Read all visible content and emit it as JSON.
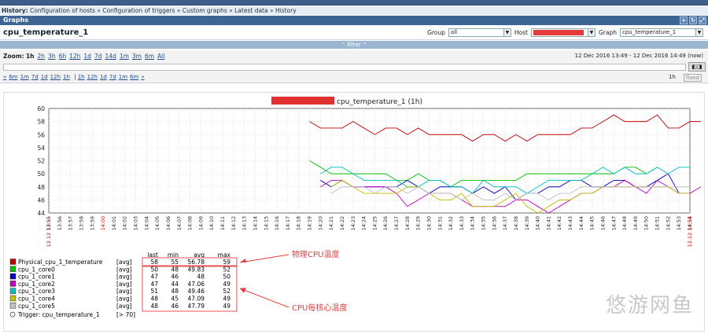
{
  "history": {
    "label": "History:",
    "crumbs": "Configuration of hosts » Configuration of triggers » Custom graphs » Latest data » History"
  },
  "header": {
    "section": "Graphs"
  },
  "page_title": "cpu_temperature_1",
  "filters": {
    "group_label": "Group",
    "group_value": "all",
    "host_label": "Host",
    "graph_label": "Graph",
    "graph_value": "cpu_temperature_1"
  },
  "filter_bar": "⌃ Filter ⌃",
  "zoom": {
    "label": "Zoom:",
    "options": [
      "1h",
      "2h",
      "3h",
      "6h",
      "12h",
      "1d",
      "7d",
      "14d",
      "1m",
      "3m",
      "6m",
      "All"
    ],
    "range_from": "12 Dec 2016 13:49",
    "range_sep": "-",
    "range_to": "12 Dec 2016 14:49",
    "range_now": "(now)"
  },
  "nav": {
    "back_links": [
      "«",
      "6m",
      "1m",
      "7d",
      "1d",
      "12h",
      "1h"
    ],
    "fwd_links": [
      "1h",
      "12h",
      "1d",
      "7d",
      "1m",
      "6m",
      "»"
    ],
    "right_value": "1h",
    "fixed": "fixed"
  },
  "chart_data": {
    "type": "line",
    "title": "cpu_temperature_1 (1h)",
    "ylim": [
      44,
      60
    ],
    "yticks": [
      44,
      46,
      48,
      50,
      52,
      54,
      56,
      58,
      60
    ],
    "x": [
      "13:55",
      "13:56",
      "13:57",
      "13:58",
      "13:59",
      "14:00",
      "14:01",
      "14:02",
      "14:03",
      "14:04",
      "14:05",
      "14:06",
      "14:07",
      "14:08",
      "14:09",
      "14:10",
      "14:11",
      "14:12",
      "14:13",
      "14:14",
      "14:15",
      "14:16",
      "14:17",
      "14:18",
      "14:19",
      "14:20",
      "14:21",
      "14:22",
      "14:23",
      "14:24",
      "14:25",
      "14:26",
      "14:27",
      "14:28",
      "14:29",
      "14:30",
      "14:31",
      "14:32",
      "14:33",
      "14:34",
      "14:35",
      "14:36",
      "14:37",
      "14:38",
      "14:39",
      "14:40",
      "14:41",
      "14:42",
      "14:43",
      "14:44",
      "14:45",
      "14:46",
      "14:47",
      "14:48",
      "14:49",
      "14:50",
      "14:51",
      "14:52",
      "14:53",
      "14:54"
    ],
    "x_start_label": "12.12 13:55",
    "x_end_label": "12.12 14:55",
    "series": [
      {
        "name": "Physical_cpu_1_temperature",
        "color": "#c00000",
        "start": "14:19",
        "values": [
          58,
          57,
          57,
          57,
          58,
          57,
          56,
          57,
          57,
          56,
          57,
          56,
          56,
          56,
          56,
          55,
          56,
          56,
          55,
          56,
          55,
          56,
          56,
          56,
          56,
          57,
          57,
          58,
          59,
          58,
          58,
          58,
          59,
          57,
          57,
          58,
          58
        ]
      },
      {
        "name": "cpu_1_core0",
        "color": "#00c000",
        "start": "14:19",
        "values": [
          52,
          51,
          50,
          50,
          50,
          50,
          50,
          50,
          49,
          49,
          50,
          49,
          49,
          48,
          49,
          49,
          49,
          49,
          49,
          49,
          50,
          50,
          50,
          50,
          50,
          50,
          50,
          50,
          50,
          51,
          51,
          50,
          51
        ]
      },
      {
        "name": "cpu_1_core1",
        "color": "#0000c0",
        "start": "14:20",
        "values": [
          49,
          48,
          49,
          48,
          48,
          48,
          48,
          48,
          49,
          48,
          47,
          48,
          48,
          48,
          47,
          48,
          47,
          48,
          46,
          47,
          47,
          48,
          48,
          49,
          49,
          48,
          48,
          49,
          49,
          48,
          48,
          49,
          50,
          47,
          47
        ]
      },
      {
        "name": "cpu_1_core2",
        "color": "#c000c0",
        "start": "14:20",
        "values": [
          48,
          49,
          49,
          48,
          48,
          48,
          48,
          47,
          45,
          46,
          47,
          47,
          47,
          46,
          45,
          45,
          45,
          45,
          46,
          46,
          45,
          44,
          45,
          46,
          47,
          47,
          48,
          48,
          49,
          48,
          47,
          49,
          48,
          47,
          47,
          48
        ]
      },
      {
        "name": "cpu_1_core3",
        "color": "#00c0c0",
        "start": "14:20",
        "values": [
          50,
          51,
          51,
          50,
          49,
          49,
          49,
          49,
          48,
          48,
          49,
          49,
          48,
          48,
          47,
          49,
          48,
          48,
          48,
          47,
          48,
          49,
          49,
          49,
          49,
          50,
          51,
          50,
          51,
          50,
          50,
          51,
          50,
          51,
          51
        ]
      },
      {
        "name": "cpu_1_core4",
        "color": "#c0c000",
        "start": "14:21",
        "values": [
          48,
          49,
          48,
          47,
          47,
          47,
          47,
          48,
          48,
          47,
          46,
          46,
          47,
          45,
          45,
          45,
          46,
          47,
          45,
          44,
          45,
          46,
          46,
          47,
          47,
          48,
          48,
          48,
          48,
          48,
          48,
          48,
          47,
          47
        ]
      },
      {
        "name": "cpu_1_core5",
        "color": "#c0c0c0",
        "start": "14:21",
        "values": [
          47,
          48,
          48,
          48,
          47,
          48,
          48,
          47,
          48,
          47,
          47,
          47,
          46,
          47,
          46,
          46,
          47,
          46,
          47,
          47,
          46,
          47,
          47,
          48,
          48,
          48,
          48,
          48,
          48,
          48,
          48,
          48,
          48,
          48
        ]
      }
    ],
    "legend_headers": [
      "last",
      "min",
      "avg",
      "max"
    ],
    "legend": [
      {
        "name": "Physical_cpu_1_temperature",
        "func": "[avg]",
        "last": "58",
        "min": "55",
        "avg": "56.78",
        "max": "59",
        "color": "#c00000"
      },
      {
        "name": "cpu_1_core0",
        "func": "[avg]",
        "last": "50",
        "min": "48",
        "avg": "49.83",
        "max": "52",
        "color": "#00c000"
      },
      {
        "name": "cpu_1_core1",
        "func": "[avg]",
        "last": "47",
        "min": "46",
        "avg": "48",
        "max": "50",
        "color": "#0000c0"
      },
      {
        "name": "cpu_1_core2",
        "func": "[avg]",
        "last": "47",
        "min": "44",
        "avg": "47.06",
        "max": "49",
        "color": "#c000c0"
      },
      {
        "name": "cpu_1_core3",
        "func": "[avg]",
        "last": "51",
        "min": "48",
        "avg": "49.46",
        "max": "52",
        "color": "#00c0c0"
      },
      {
        "name": "cpu_1_core4",
        "func": "[avg]",
        "last": "48",
        "min": "45",
        "avg": "47.09",
        "max": "49",
        "color": "#c0c000"
      },
      {
        "name": "cpu_1_core5",
        "func": "[avg]",
        "last": "48",
        "min": "46",
        "avg": "47.79",
        "max": "49",
        "color": "#c0c0c0"
      }
    ],
    "trigger": {
      "label": "Trigger: cpu_temperature_1",
      "cond": "[> 70]"
    },
    "annotations": {
      "physical": "物理CPU温度",
      "cores": "CPU每核心温度"
    }
  },
  "watermark": "悠游网鱼"
}
